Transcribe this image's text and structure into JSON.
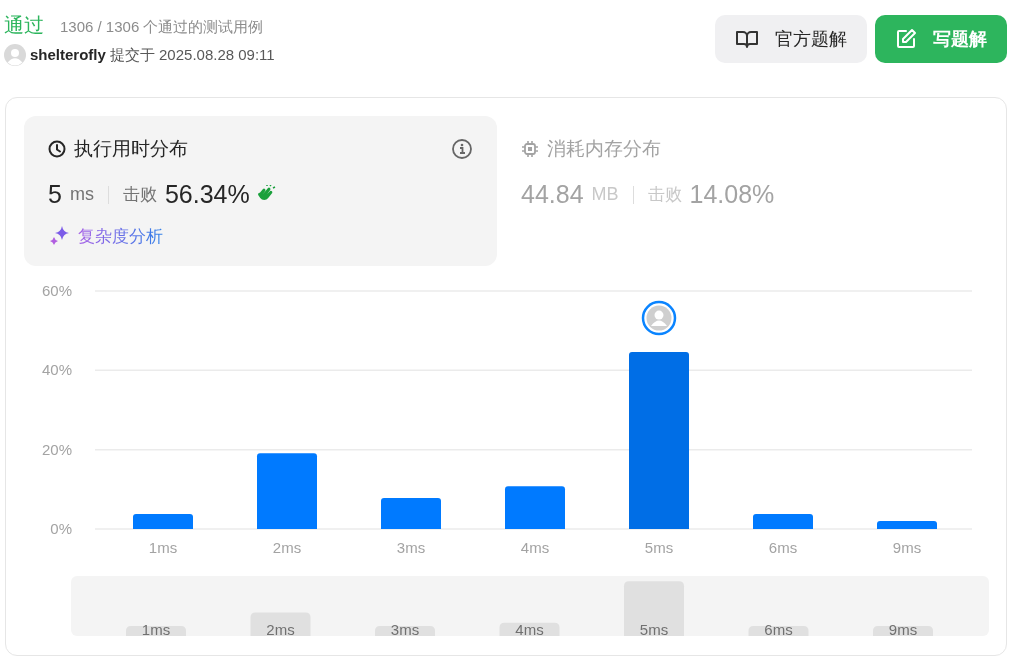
{
  "header": {
    "status": "通过",
    "testcases": "1306 / 1306 个通过的测试用例",
    "user": "shelterofly",
    "submitted": "提交于 2025.08.28 09:11"
  },
  "buttons": [
    {
      "label": "官方题解",
      "kind": "secondary"
    },
    {
      "label": "写题解",
      "kind": "primary"
    }
  ],
  "panels": [
    {
      "title": "执行用时分布",
      "kind": "runtime",
      "selected": true,
      "value": "5",
      "unit": "ms",
      "beats_label": "击败",
      "beats": "56.34%",
      "link": "复杂度分析"
    },
    {
      "title": "消耗内存分布",
      "kind": "memory",
      "selected": false,
      "value": "44.84",
      "unit": "MB",
      "beats_label": "击败",
      "beats": "14.08%"
    }
  ],
  "chart": {
    "chart_data": {
      "type": "bar",
      "categories": [
        "1ms",
        "2ms",
        "3ms",
        "4ms",
        "5ms",
        "6ms",
        "9ms"
      ],
      "values": [
        3.8,
        19.1,
        7.8,
        10.8,
        44.6,
        3.8,
        2.0
      ],
      "ylim": [
        0,
        60
      ],
      "yticks": [
        {
          "value": 0,
          "label": "0%"
        },
        {
          "value": 20,
          "label": "20%"
        },
        {
          "value": 40,
          "label": "40%"
        },
        {
          "value": 60,
          "label": "60%"
        }
      ]
    },
    "bar_states": [
      {
        "selected": false
      },
      {
        "selected": false
      },
      {
        "selected": false
      },
      {
        "selected": false
      },
      {
        "selected": true
      },
      {
        "selected": false
      },
      {
        "selected": false
      }
    ],
    "navigator": {
      "labels": [
        "1ms",
        "2ms",
        "3ms",
        "4ms",
        "5ms",
        "6ms",
        "9ms"
      ]
    }
  }
}
